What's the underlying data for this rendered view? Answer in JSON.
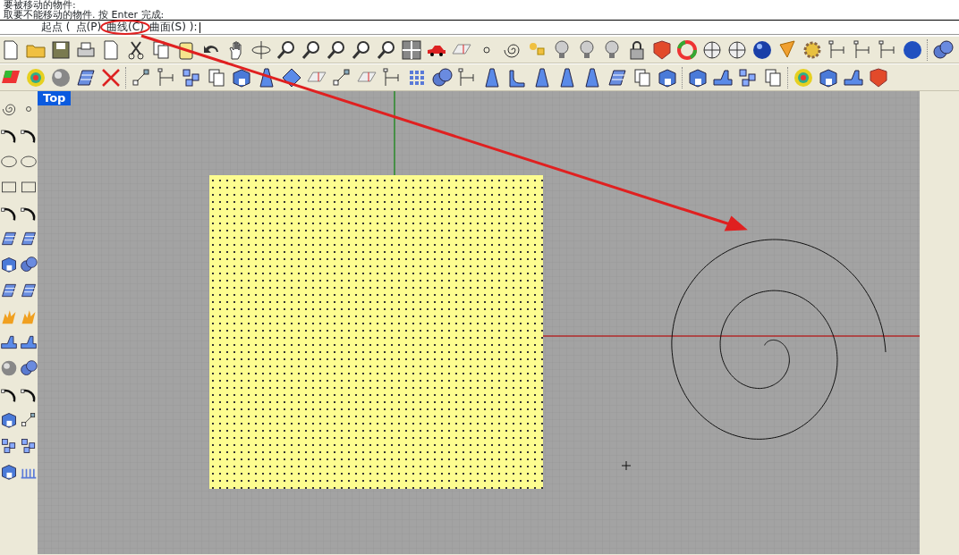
{
  "command_history": [
    "要被移动的物件:",
    "取要不能移动的物件. 按 Enter 完成:"
  ],
  "command_prompt": {
    "label": "起点 (",
    "options": [
      "点(P)",
      "曲线(C)",
      "曲面(S)"
    ],
    "end": "):"
  },
  "viewport": {
    "label": "Top"
  }
}
